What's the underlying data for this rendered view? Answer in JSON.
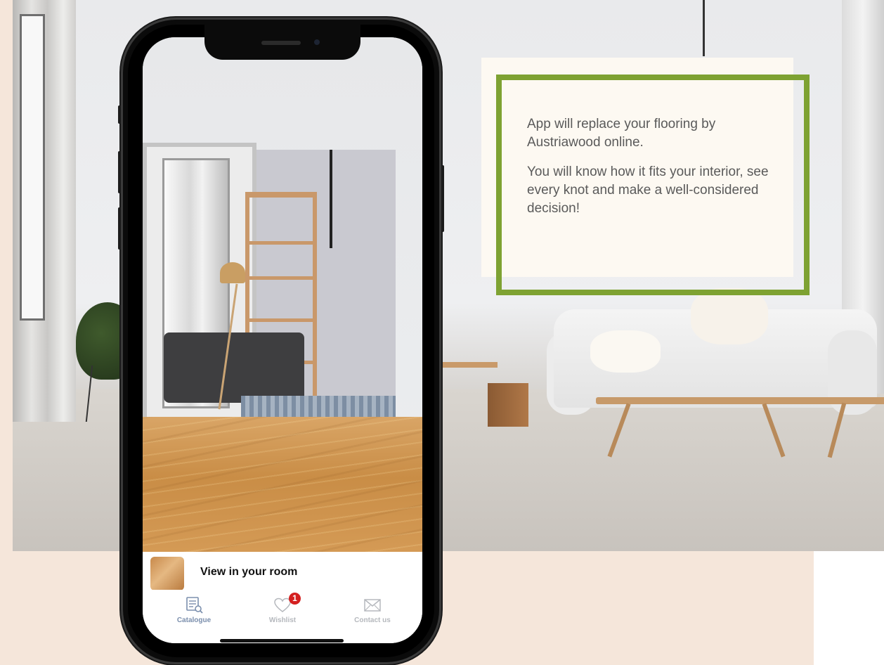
{
  "info": {
    "paragraph1": "App will replace your flooring by Austriawood online.",
    "paragraph2": "You will know how it fits your interior, see every knot and make a well-considered decision!"
  },
  "app": {
    "view_in_room": "View in your room",
    "tabs": [
      {
        "label": "Catalogue",
        "icon": "catalogue-icon",
        "active": true
      },
      {
        "label": "Wishlist",
        "icon": "heart-icon",
        "badge": "1"
      },
      {
        "label": "Contact us",
        "icon": "mail-icon"
      }
    ]
  },
  "colors": {
    "accent_green": "#7ea232",
    "background_beige": "#f5e6da",
    "tab_active": "#7b8fad",
    "tab_inactive": "#b5b8bd",
    "badge_red": "#d41f1f"
  }
}
